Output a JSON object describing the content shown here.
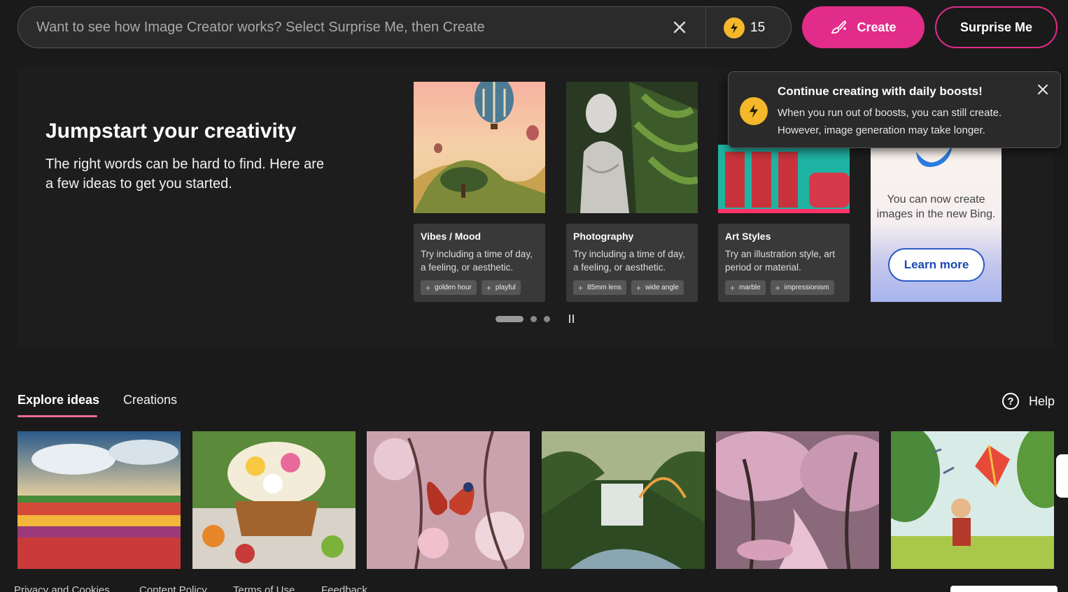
{
  "search": {
    "placeholder": "Want to see how Image Creator works? Select Surprise Me, then Create",
    "boosts": "15"
  },
  "buttons": {
    "create": "Create",
    "surprise": "Surprise Me"
  },
  "hero": {
    "title": "Jumpstart your creativity",
    "subtitle": "The right words can be hard to find. Here are a few ideas to get you started.",
    "cards": [
      {
        "title": "Vibes / Mood",
        "desc": "Try including a time of day, a feeling, or aesthetic.",
        "chips": [
          "golden hour",
          "playful"
        ]
      },
      {
        "title": "Photography",
        "desc": "Try including a time of day, a feeling, or aesthetic.",
        "chips": [
          "85mm lens",
          "wide angle"
        ]
      },
      {
        "title": "Art Styles",
        "desc": "Try an illustration style, art period or material.",
        "chips": [
          "marble",
          "impressionism"
        ]
      }
    ],
    "promo": {
      "text": "You can now create images in the new Bing.",
      "button": "Learn more"
    },
    "carousel": {
      "pages": 3,
      "active": 0
    }
  },
  "toast": {
    "title": "Continue creating with daily boosts!",
    "text": "When you run out of boosts, you can still create. However, image generation may take longer."
  },
  "tabs": {
    "explore": "Explore ideas",
    "creations": "Creations",
    "help": "Help"
  },
  "footer": {
    "links": [
      "Privacy and Cookies",
      "Content Policy",
      "Terms of Use",
      "Feedback"
    ]
  },
  "colors": {
    "accent": "#e12c8a",
    "boost": "#f5b82b",
    "background": "#1b1a1a"
  }
}
